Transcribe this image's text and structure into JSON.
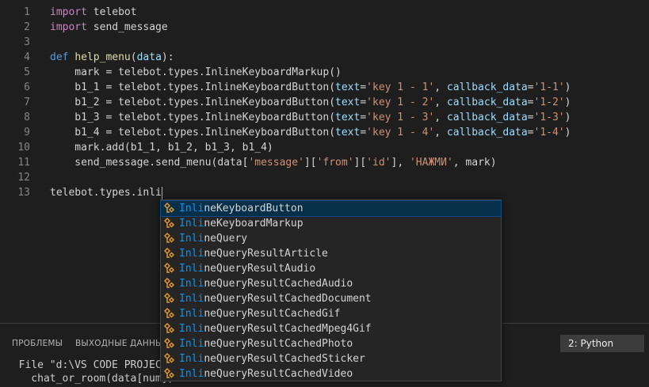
{
  "editor": {
    "lines": [
      {
        "n": "1",
        "tokens": [
          {
            "t": "import",
            "c": "kw"
          },
          {
            "t": " telebot",
            "c": "pl"
          }
        ]
      },
      {
        "n": "2",
        "tokens": [
          {
            "t": "import",
            "c": "kw"
          },
          {
            "t": " send_message",
            "c": "pl"
          }
        ]
      },
      {
        "n": "3",
        "tokens": []
      },
      {
        "n": "4",
        "tokens": [
          {
            "t": "def",
            "c": "kwd"
          },
          {
            "t": " ",
            "c": "pl"
          },
          {
            "t": "help_menu",
            "c": "fn"
          },
          {
            "t": "(",
            "c": "pl"
          },
          {
            "t": "data",
            "c": "prm"
          },
          {
            "t": "):",
            "c": "pl"
          }
        ]
      },
      {
        "n": "5",
        "tokens": [
          {
            "t": "    mark = telebot.types.InlineKeyboardMarkup()",
            "c": "pl"
          }
        ]
      },
      {
        "n": "6",
        "tokens": [
          {
            "t": "    b1_1 = telebot.types.InlineKeyboardButton(",
            "c": "pl"
          },
          {
            "t": "text",
            "c": "prm"
          },
          {
            "t": "=",
            "c": "pl"
          },
          {
            "t": "'key 1 - 1'",
            "c": "str"
          },
          {
            "t": ", ",
            "c": "pl"
          },
          {
            "t": "callback_data",
            "c": "prm"
          },
          {
            "t": "=",
            "c": "pl"
          },
          {
            "t": "'1-1'",
            "c": "str"
          },
          {
            "t": ")",
            "c": "pl"
          }
        ]
      },
      {
        "n": "7",
        "tokens": [
          {
            "t": "    b1_2 = telebot.types.InlineKeyboardButton(",
            "c": "pl"
          },
          {
            "t": "text",
            "c": "prm"
          },
          {
            "t": "=",
            "c": "pl"
          },
          {
            "t": "'key 1 - 2'",
            "c": "str"
          },
          {
            "t": ", ",
            "c": "pl"
          },
          {
            "t": "callback_data",
            "c": "prm"
          },
          {
            "t": "=",
            "c": "pl"
          },
          {
            "t": "'1-2'",
            "c": "str"
          },
          {
            "t": ")",
            "c": "pl"
          }
        ]
      },
      {
        "n": "8",
        "tokens": [
          {
            "t": "    b1_3 = telebot.types.InlineKeyboardButton(",
            "c": "pl"
          },
          {
            "t": "text",
            "c": "prm"
          },
          {
            "t": "=",
            "c": "pl"
          },
          {
            "t": "'key 1 - 3'",
            "c": "str"
          },
          {
            "t": ", ",
            "c": "pl"
          },
          {
            "t": "callback_data",
            "c": "prm"
          },
          {
            "t": "=",
            "c": "pl"
          },
          {
            "t": "'1-3'",
            "c": "str"
          },
          {
            "t": ")",
            "c": "pl"
          }
        ]
      },
      {
        "n": "9",
        "tokens": [
          {
            "t": "    b1_4 = telebot.types.InlineKeyboardButton(",
            "c": "pl"
          },
          {
            "t": "text",
            "c": "prm"
          },
          {
            "t": "=",
            "c": "pl"
          },
          {
            "t": "'key 1 - 4'",
            "c": "str"
          },
          {
            "t": ", ",
            "c": "pl"
          },
          {
            "t": "callback_data",
            "c": "prm"
          },
          {
            "t": "=",
            "c": "pl"
          },
          {
            "t": "'1-4'",
            "c": "str"
          },
          {
            "t": ")",
            "c": "pl"
          }
        ]
      },
      {
        "n": "10",
        "tokens": [
          {
            "t": "    mark.add(b1_1, b1_2, b1_3, b1_4)",
            "c": "pl"
          }
        ]
      },
      {
        "n": "11",
        "tokens": [
          {
            "t": "    send_message.send_menu(data[",
            "c": "pl"
          },
          {
            "t": "'message'",
            "c": "str"
          },
          {
            "t": "][",
            "c": "pl"
          },
          {
            "t": "'from'",
            "c": "str"
          },
          {
            "t": "][",
            "c": "pl"
          },
          {
            "t": "'id'",
            "c": "str"
          },
          {
            "t": "], ",
            "c": "pl"
          },
          {
            "t": "'НАЖМИ'",
            "c": "str"
          },
          {
            "t": ", mark)",
            "c": "pl"
          }
        ]
      },
      {
        "n": "12",
        "tokens": []
      },
      {
        "n": "13",
        "tokens": [
          {
            "t": "telebot.types.inli",
            "c": "pl"
          }
        ],
        "cursor": true
      }
    ]
  },
  "suggest": {
    "match": "Inli",
    "icon": "class-icon",
    "items": [
      {
        "rest": "neKeyboardButton"
      },
      {
        "rest": "neKeyboardMarkup"
      },
      {
        "rest": "neQuery"
      },
      {
        "rest": "neQueryResultArticle"
      },
      {
        "rest": "neQueryResultAudio"
      },
      {
        "rest": "neQueryResultCachedAudio"
      },
      {
        "rest": "neQueryResultCachedDocument"
      },
      {
        "rest": "neQueryResultCachedGif"
      },
      {
        "rest": "neQueryResultCachedMpeg4Gif"
      },
      {
        "rest": "neQueryResultCachedPhoto"
      },
      {
        "rest": "neQueryResultCachedSticker"
      },
      {
        "rest": "neQueryResultCachedVideo"
      }
    ],
    "selected_index": 0
  },
  "panel": {
    "tabs": [
      "ПРОБЛЕМЫ",
      "ВЫХОДНЫЕ ДАННЫЕ"
    ],
    "terminal_select": "2: Python",
    "terminal_lines": [
      "  File \"d:\\VS CODE PROJECT\\",
      "    chat_or_room(data[num])"
    ]
  },
  "colors": {
    "background": "#1e1e1e",
    "keyword": "#c586c0",
    "def_keyword": "#569cd6",
    "function": "#dcdcaa",
    "parameter": "#9cdcfe",
    "string": "#ce9178",
    "match_highlight": "#0097fb",
    "icon_orange": "#ee9d28"
  }
}
